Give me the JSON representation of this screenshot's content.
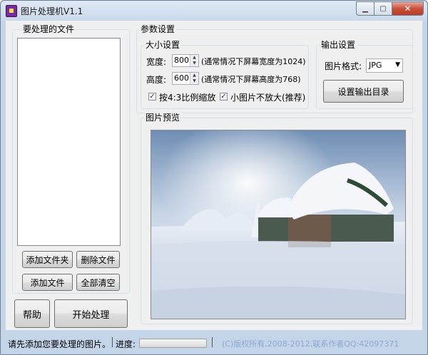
{
  "window": {
    "title": "图片处理机V1.1"
  },
  "files_group": {
    "legend": "要处理的文件"
  },
  "buttons": {
    "add_folder": "添加文件夹",
    "delete_file": "删除文件",
    "add_file": "添加文件",
    "clear_all": "全部清空",
    "help": "帮助",
    "start": "开始处理",
    "set_output_dir": "设置输出目录"
  },
  "params": {
    "legend": "参数设置",
    "size": {
      "legend": "大小设置",
      "width_label": "宽度:",
      "width_value": "800",
      "width_hint": "(通常情况下屏幕宽度为1024)",
      "height_label": "高度:",
      "height_value": "600",
      "height_hint": "(通常情况下屏幕高度为768)",
      "keep_ratio_label": "按4:3比例缩放",
      "keep_ratio_checked": true,
      "no_upscale_label": "小图片不放大(推荐)",
      "no_upscale_checked": true
    },
    "output": {
      "legend": "输出设置",
      "format_label": "图片格式:",
      "format_value": "JPG"
    }
  },
  "preview": {
    "legend": "图片预览"
  },
  "status": {
    "message": "请先添加您要处理的图片。",
    "progress_label": "进度:",
    "progress": 0,
    "copyright": "(C)版权所有,2008-2012,联系作者QQ:42097371"
  }
}
